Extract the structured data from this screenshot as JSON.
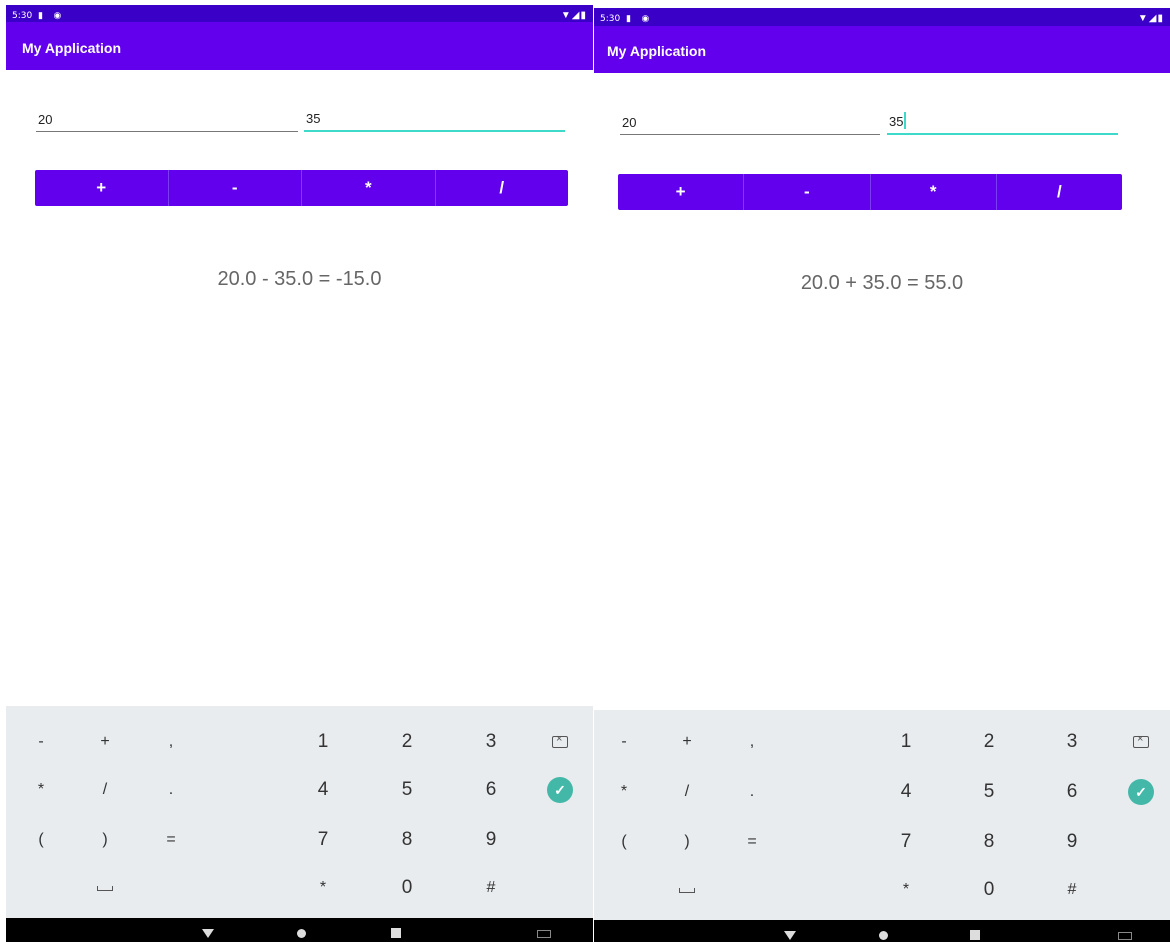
{
  "colors": {
    "status_bar": "#3b00c8",
    "app_bar": "#6200ee",
    "accent": "#3dd9c9",
    "done_key": "#44b8a8",
    "keyboard_bg": "#e8ecef"
  },
  "screens": [
    {
      "status": {
        "time": "5:30",
        "left_icons": "▮ ◉",
        "right_icons": "▼◢▮"
      },
      "app": {
        "title": "My Application"
      },
      "inputs": {
        "first": "20",
        "second": "35"
      },
      "operators": [
        "+",
        "-",
        "*",
        "/"
      ],
      "result": "20.0 - 35.0 = -15.0",
      "keyboard": {
        "row1": [
          "-",
          "+",
          ",",
          "1",
          "2",
          "3"
        ],
        "row2": [
          "*",
          "/",
          ".",
          "4",
          "5",
          "6"
        ],
        "row3": [
          "(",
          ")",
          "=",
          "7",
          "8",
          "9"
        ],
        "row4": [
          "*",
          "0",
          "#"
        ]
      }
    },
    {
      "status": {
        "time": "5:30",
        "left_icons": "▮ ◉",
        "right_icons": "▼◢▮"
      },
      "app": {
        "title": "My Application"
      },
      "inputs": {
        "first": "20",
        "second": "35"
      },
      "operators": [
        "+",
        "-",
        "*",
        "/"
      ],
      "result": "20.0 + 35.0 = 55.0",
      "keyboard": {
        "row1": [
          "-",
          "+",
          ",",
          "1",
          "2",
          "3"
        ],
        "row2": [
          "*",
          "/",
          ".",
          "4",
          "5",
          "6"
        ],
        "row3": [
          "(",
          ")",
          "=",
          "7",
          "8",
          "9"
        ],
        "row4": [
          "*",
          "0",
          "#"
        ]
      }
    }
  ],
  "icons": {
    "backspace": "backspace-icon",
    "done": "check-icon",
    "space": "space-icon",
    "back": "nav-back-icon",
    "home": "nav-home-icon",
    "recents": "nav-recents-icon",
    "keyboard": "keyboard-switch-icon"
  }
}
